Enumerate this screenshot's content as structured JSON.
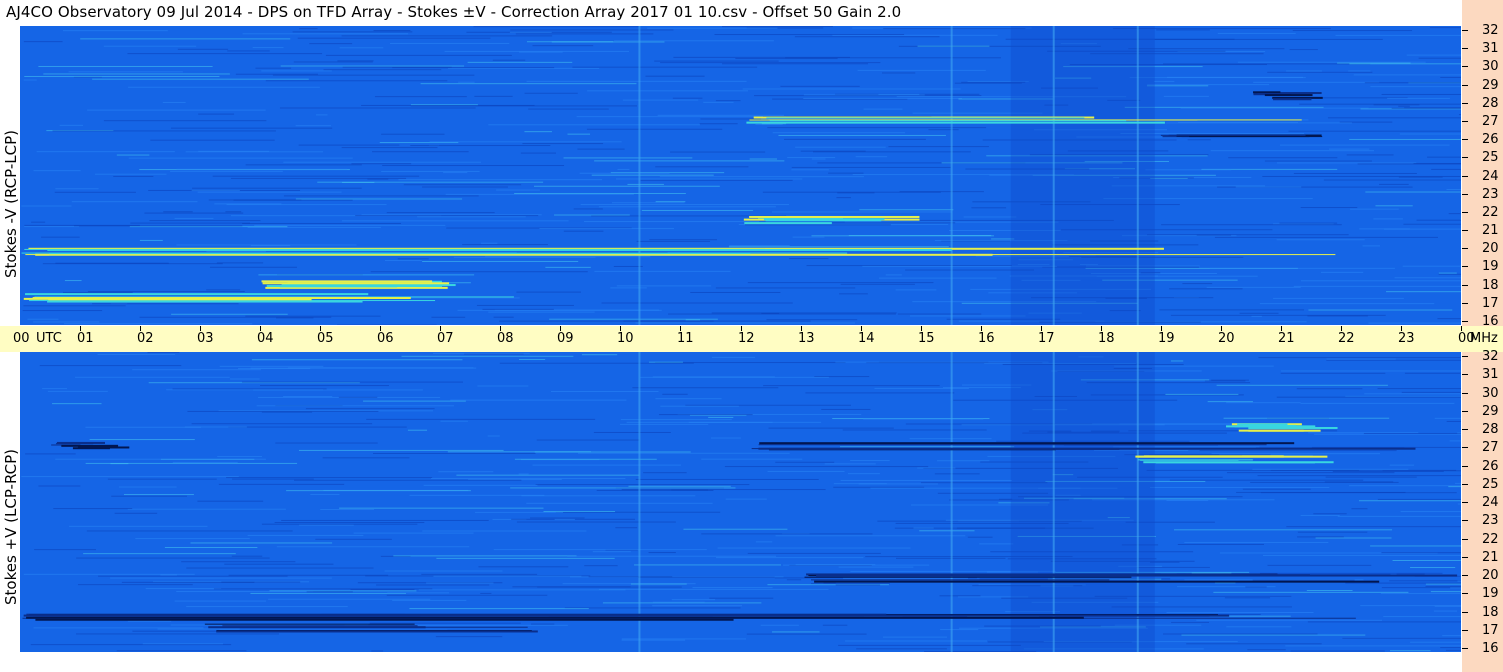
{
  "header": {
    "title": "AJ4CO Observatory  09 Jul 2014  -  DPS on TFD Array  -  Stokes ±V  -  Correction Array 2017 01 10.csv  -  Offset 50  Gain 2.0"
  },
  "time_axis": {
    "utc_label": "UTC",
    "unit_label": "MHz",
    "first_label": "00",
    "labels": [
      "01",
      "02",
      "03",
      "04",
      "05",
      "06",
      "07",
      "08",
      "09",
      "10",
      "11",
      "12",
      "13",
      "14",
      "15",
      "16",
      "17",
      "18",
      "19",
      "20",
      "21",
      "22",
      "23",
      "00"
    ]
  },
  "panels": [
    {
      "name": "top",
      "ylabel": "Stokes -V (RCP-LCP)"
    },
    {
      "name": "bottom",
      "ylabel": "Stokes +V (LCP-RCP)"
    }
  ],
  "colors": {
    "background_blue": "#1565e6",
    "panel_bg": "#1565e6",
    "freq_stripe": "#fcd9c0",
    "time_band": "#fffdc3"
  },
  "chart_data": [
    {
      "type": "heatmap",
      "title": "Stokes -V (RCP-LCP)",
      "xlabel": "UTC",
      "ylabel": "MHz",
      "x_range": [
        0,
        24
      ],
      "y_range": [
        16,
        32
      ],
      "y_ticks": [
        16,
        17,
        18,
        19,
        20,
        21,
        22,
        23,
        24,
        25,
        26,
        27,
        28,
        29,
        30,
        31,
        32
      ],
      "features": [
        {
          "freq_mhz": 27.0,
          "utc_start": 12.0,
          "utc_end": 23.7,
          "polarity": "positive"
        },
        {
          "freq_mhz": 26.2,
          "utc_start": 19.0,
          "utc_end": 21.5,
          "polarity": "negative"
        },
        {
          "freq_mhz": 28.3,
          "utc_start": 20.5,
          "utc_end": 21.5,
          "polarity": "negative"
        },
        {
          "freq_mhz": 21.7,
          "utc_start": 12.0,
          "utc_end": 15.0,
          "polarity": "positive"
        },
        {
          "freq_mhz": 20.0,
          "utc_start": 0.0,
          "utc_end": 24.0,
          "polarity": "positive"
        },
        {
          "freq_mhz": 17.5,
          "utc_start": 0.0,
          "utc_end": 9.0,
          "polarity": "positive"
        },
        {
          "freq_mhz": 18.2,
          "utc_start": 4.0,
          "utc_end": 8.0,
          "polarity": "positive"
        }
      ]
    },
    {
      "type": "heatmap",
      "title": "Stokes +V (LCP-RCP)",
      "xlabel": "UTC",
      "ylabel": "MHz",
      "x_range": [
        0,
        24
      ],
      "y_range": [
        16,
        32
      ],
      "y_ticks": [
        16,
        17,
        18,
        19,
        20,
        21,
        22,
        23,
        24,
        25,
        26,
        27,
        28,
        29,
        30,
        31,
        32
      ],
      "features": [
        {
          "freq_mhz": 27.0,
          "utc_start": 0.5,
          "utc_end": 1.5,
          "polarity": "negative"
        },
        {
          "freq_mhz": 27.0,
          "utc_start": 12.0,
          "utc_end": 23.7,
          "polarity": "negative"
        },
        {
          "freq_mhz": 26.3,
          "utc_start": 18.5,
          "utc_end": 22.0,
          "polarity": "positive"
        },
        {
          "freq_mhz": 28.0,
          "utc_start": 20.0,
          "utc_end": 21.5,
          "polarity": "positive"
        },
        {
          "freq_mhz": 20.0,
          "utc_start": 13.0,
          "utc_end": 24.0,
          "polarity": "negative"
        },
        {
          "freq_mhz": 17.9,
          "utc_start": 0.0,
          "utc_end": 24.0,
          "polarity": "negative"
        },
        {
          "freq_mhz": 17.3,
          "utc_start": 3.0,
          "utc_end": 9.0,
          "polarity": "negative"
        }
      ]
    }
  ]
}
